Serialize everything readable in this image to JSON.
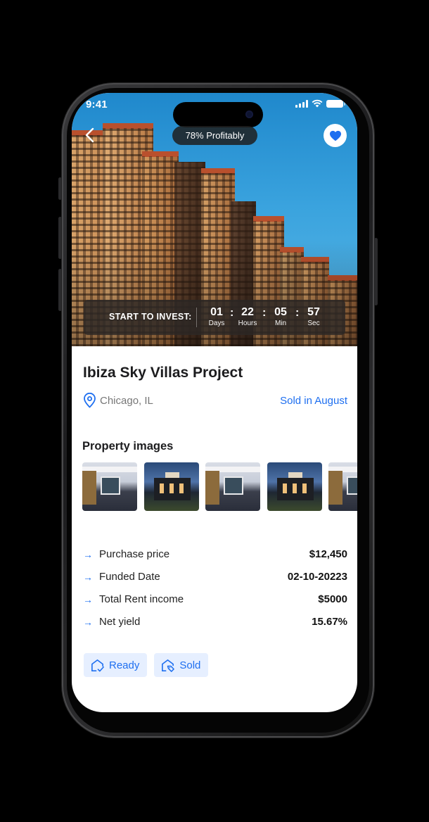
{
  "status_bar": {
    "time": "9:41"
  },
  "hero": {
    "profit_badge": "78% Profitably",
    "favorite_active": true,
    "countdown": {
      "label": "START TO INVEST:",
      "units": [
        {
          "value": "01",
          "label": "Days"
        },
        {
          "value": "22",
          "label": "Hours"
        },
        {
          "value": "05",
          "label": "Min"
        },
        {
          "value": "57",
          "label": "Sec"
        }
      ]
    }
  },
  "property": {
    "title": "Ibiza Sky Villas Project",
    "location": "Chicago, IL",
    "sold_status": "Sold in August"
  },
  "gallery": {
    "title": "Property images",
    "images": [
      "modern-house-day",
      "modern-house-dusk",
      "modern-house-day",
      "modern-house-dusk",
      "modern-house-day"
    ]
  },
  "details": [
    {
      "label": "Purchase price",
      "value": "$12,450"
    },
    {
      "label": "Funded Date",
      "value": "02-10-20223"
    },
    {
      "label": "Total Rent income",
      "value": "$5000"
    },
    {
      "label": "Net yield",
      "value": "15.67%"
    }
  ],
  "tags": [
    {
      "label": "Ready",
      "icon": "home-check-icon"
    },
    {
      "label": "Sold",
      "icon": "home-tag-icon"
    }
  ],
  "colors": {
    "accent": "#1e6ff0",
    "tag_bg": "#e6efff"
  }
}
